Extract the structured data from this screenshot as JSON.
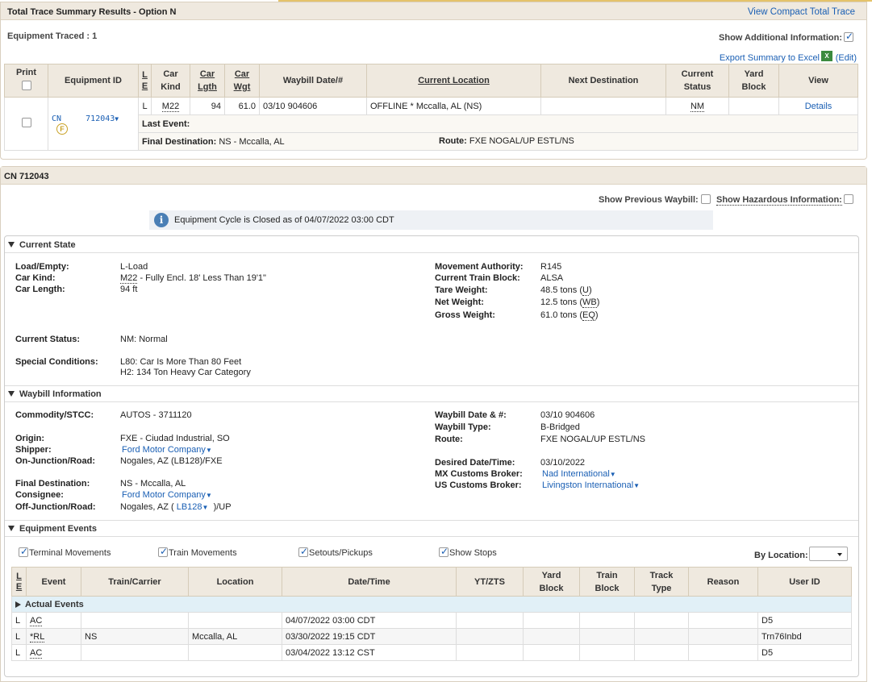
{
  "summary": {
    "title": "Total Trace Summary Results - Option N",
    "compact_link": "View Compact Total Trace",
    "equipment_traced": "Equipment Traced : 1",
    "show_additional_label": "Show Additional Information:",
    "export_label": "Export Summary to Excel",
    "excel_icon": "X",
    "edit_label": "(Edit)",
    "columns": {
      "print": "Print",
      "equipment_id": "Equipment ID",
      "le_l": "L",
      "le_e": "E",
      "car_kind_1": "Car",
      "car_kind_2": "Kind",
      "car_lgth_1": "Car",
      "car_lgth_2": "Lgth",
      "car_wgt_1": "Car",
      "car_wgt_2": "Wgt",
      "waybill": "Waybill Date/#",
      "current_location": "Current Location",
      "next_destination": "Next Destination",
      "current_status_1": "Current",
      "current_status_2": "Status",
      "yard_block_1": "Yard",
      "yard_block_2": "Block",
      "view": "View"
    },
    "row": {
      "initial": "CN",
      "number": "712043",
      "le": "L",
      "car_kind": "M22",
      "car_lgth": "94",
      "car_wgt": "61.0",
      "waybill": "03/10 904606",
      "current_location": "OFFLINE * Mccalla, AL (NS)",
      "next_destination": "",
      "current_status": "NM",
      "yard_block": "",
      "view": "Details",
      "last_event_label": "Last Event:",
      "final_dest_label": "Final Destination:",
      "final_dest_value": "NS - Mccalla, AL",
      "route_label": "Route:",
      "route_value": "FXE NOGAL/UP ESTL/NS",
      "flag_icon": "F"
    }
  },
  "detail": {
    "title": "CN 712043",
    "show_prev_waybill": "Show Previous Waybill:",
    "show_hazardous": "Show Hazardous Information:",
    "cycle_banner": "Equipment Cycle is Closed as of 04/07/2022 03:00 CDT",
    "info_icon": "i",
    "current_state": {
      "heading": "Current State",
      "load_empty_label": "Load/Empty:",
      "load_empty": "L-Load",
      "car_kind_label": "Car Kind:",
      "car_kind_code": "M22",
      "car_kind_desc": " - Fully Encl. 18' Less Than 19'1\"",
      "car_length_label": "Car Length:",
      "car_length": "94 ft",
      "movement_authority_label": "Movement Authority:",
      "movement_authority": "R145",
      "current_train_block_label": "Current Train Block:",
      "current_train_block": "ALSA",
      "tare_weight_label": "Tare Weight:",
      "tare_weight": "48.5 tons (",
      "tare_weight_code": "U",
      "net_weight_label": "Net Weight:",
      "net_weight": "12.5 tons (",
      "net_weight_code": "WB",
      "gross_weight_label": "Gross Weight:",
      "gross_weight": "61.0 tons (",
      "gross_weight_code": "EQ",
      "close_paren": ")",
      "current_status_label": "Current Status:",
      "current_status": "NM: Normal",
      "special_conditions_label": "Special Conditions:",
      "special_1": "L80: Car Is More Than 80 Feet",
      "special_2": "H2: 134 Ton Heavy Car Category"
    },
    "waybill": {
      "heading": "Waybill Information",
      "commodity_label": "Commodity/STCC:",
      "commodity": "AUTOS - 3711120",
      "origin_label": "Origin:",
      "origin": "FXE - Ciudad Industrial, SO",
      "shipper_label": "Shipper:",
      "shipper": "Ford Motor Company",
      "on_junction_label": "On-Junction/Road:",
      "on_junction": "Nogales, AZ (LB128)/FXE",
      "final_dest_label": "Final Destination:",
      "final_dest": "NS - Mccalla, AL",
      "consignee_label": "Consignee:",
      "consignee": "Ford Motor Company",
      "off_junction_label": "Off-Junction/Road:",
      "off_junction_pre": "Nogales, AZ (",
      "off_junction_link": "LB128",
      "off_junction_post": ")/UP",
      "waybill_date_label": "Waybill Date & #:",
      "waybill_date": "03/10 904606",
      "waybill_type_label": "Waybill Type:",
      "waybill_type": "B-Bridged",
      "route_label": "Route:",
      "route": "FXE NOGAL/UP ESTL/NS",
      "desired_label": "Desired Date/Time:",
      "desired": "03/10/2022",
      "mx_broker_label": "MX Customs Broker:",
      "mx_broker": "Nad International",
      "us_broker_label": "US Customs Broker:",
      "us_broker": "Livingston International"
    },
    "events": {
      "heading": "Equipment Events",
      "terminal_movements": "Terminal Movements",
      "train_movements": "Train Movements",
      "setouts_pickups": "Setouts/Pickups",
      "show_stops": "Show Stops",
      "by_location": "By Location:",
      "columns": {
        "le_l": "L",
        "le_e": "E",
        "event": "Event",
        "train_carrier": "Train/Carrier",
        "location": "Location",
        "date_time": "Date/Time",
        "yt_zts": "YT/ZTS",
        "yard_block_1": "Yard",
        "yard_block_2": "Block",
        "train_block_1": "Train",
        "train_block_2": "Block",
        "track_type_1": "Track",
        "track_type_2": "Type",
        "reason": "Reason",
        "user_id": "User ID"
      },
      "actual_events": "Actual Events",
      "rows": [
        {
          "le": "L",
          "event": "AC",
          "train": "",
          "location": "",
          "datetime": "04/07/2022 03:00 CDT",
          "user": "D5"
        },
        {
          "le": "L",
          "event": "*RL",
          "train": "NS",
          "location": "Mccalla, AL",
          "datetime": "03/30/2022 19:15 CDT",
          "user": "Trn76Inbd"
        },
        {
          "le": "L",
          "event": "AC",
          "train": "",
          "location": "",
          "datetime": "03/04/2022 13:12 CST",
          "user": "D5"
        }
      ]
    }
  }
}
